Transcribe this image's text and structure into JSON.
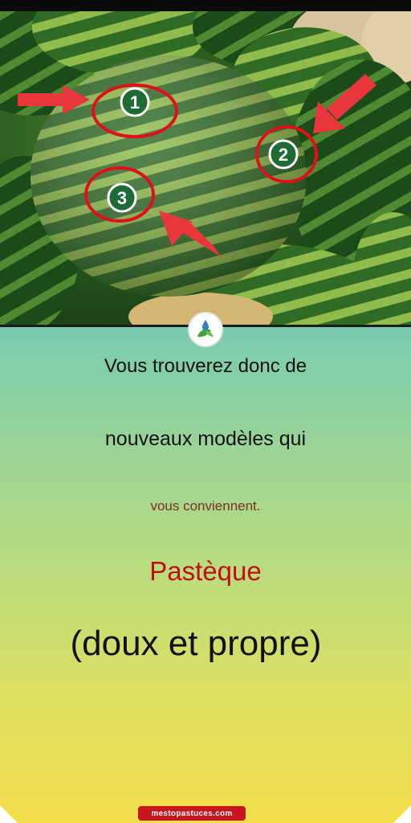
{
  "image": {
    "subject": "watermelon-icon",
    "markers": [
      "1",
      "2",
      "3"
    ],
    "marker_colors": {
      "ring": "#e0101a",
      "disc": "#1f6b35",
      "arrow": "#e8363c"
    }
  },
  "logo": {
    "icon": "leaf-droplet-icon"
  },
  "text": {
    "line1": "Vous trouverez donc de",
    "line2": "nouveaux modèles qui",
    "line3": "vous conviennent.",
    "line4": "Pastèque",
    "line5": "(doux et propre)"
  },
  "footer": {
    "site_label": "mestopastuces.com"
  }
}
